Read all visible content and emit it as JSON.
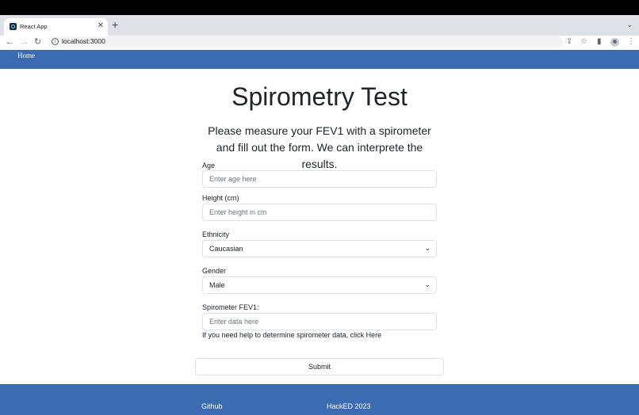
{
  "browser": {
    "tab_title": "React App",
    "tab_close": "✕",
    "new_tab": "+",
    "tab_menu": "⌄",
    "url": "localhost:3000",
    "info_icon": "i",
    "nav_back": "←",
    "nav_forward": "→",
    "nav_reload": "↻",
    "share": "⇪",
    "bookmark": "☆",
    "sidepanel": "▮",
    "menu": "⋮"
  },
  "navbar": {
    "home": "Home"
  },
  "page": {
    "title": "Spirometry Test",
    "subtitle": "Please measure your FEV1 with a spirometer and fill out the form. We can interprete the results."
  },
  "form": {
    "age": {
      "label": "Age",
      "placeholder": "Enter age here"
    },
    "height": {
      "label": "Height (cm)",
      "placeholder": "Enter height in cm"
    },
    "ethnicity": {
      "label": "Ethnicity",
      "value": "Caucasian"
    },
    "gender": {
      "label": "Gender",
      "value": "Male"
    },
    "fev1": {
      "label": "Spirometer FEV1:",
      "placeholder": "Enter data here"
    },
    "help_text": "If you need help to determine spirometer data, click Here",
    "submit": "Submit",
    "chevron": "⌄"
  },
  "footer": {
    "github": "Github",
    "hacked": "HackED 2023"
  }
}
